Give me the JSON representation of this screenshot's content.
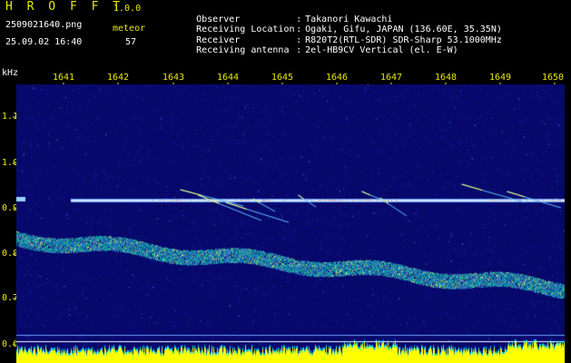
{
  "header": {
    "app_title": "H R O F F T",
    "app_version": "1.0.0",
    "file_name": "2509021640.png",
    "meteor_label": "meteor",
    "date_time": "25.09.02 16:40",
    "meteor_count": "57"
  },
  "info": [
    {
      "key": "Observer",
      "sep": ":",
      "value": "Takanori Kawachi"
    },
    {
      "key": "Receiving Location",
      "sep": ":",
      "value": "Ogaki, Gifu, JAPAN (136.60E, 35.35N)"
    },
    {
      "key": "Receiver",
      "sep": ":",
      "value": "R820T2(RTL-SDR) SDR-Sharp 53.1000MHz"
    },
    {
      "key": "Receiving antenna",
      "sep": ":",
      "value": "2el-HB9CV Vertical (el. E-W)"
    }
  ],
  "axes": {
    "freq_unit": "kHz",
    "time_ticks": [
      "1641",
      "1642",
      "1643",
      "1644",
      "1645",
      "1646",
      "1647",
      "1648",
      "1649",
      "1650"
    ],
    "freq_ticks": [
      "1.1",
      "1.0",
      "0.9",
      "0.8",
      "0.7",
      "0.6"
    ]
  },
  "colors": {
    "label_yellow": "#e8e800",
    "text_white": "#ffffff",
    "background": "#000000",
    "spectro_bg": "#07086a",
    "carrier_line": "#d0e8ff",
    "noise_band": "#00c0a0",
    "bottom_band": "#ffff00"
  }
}
